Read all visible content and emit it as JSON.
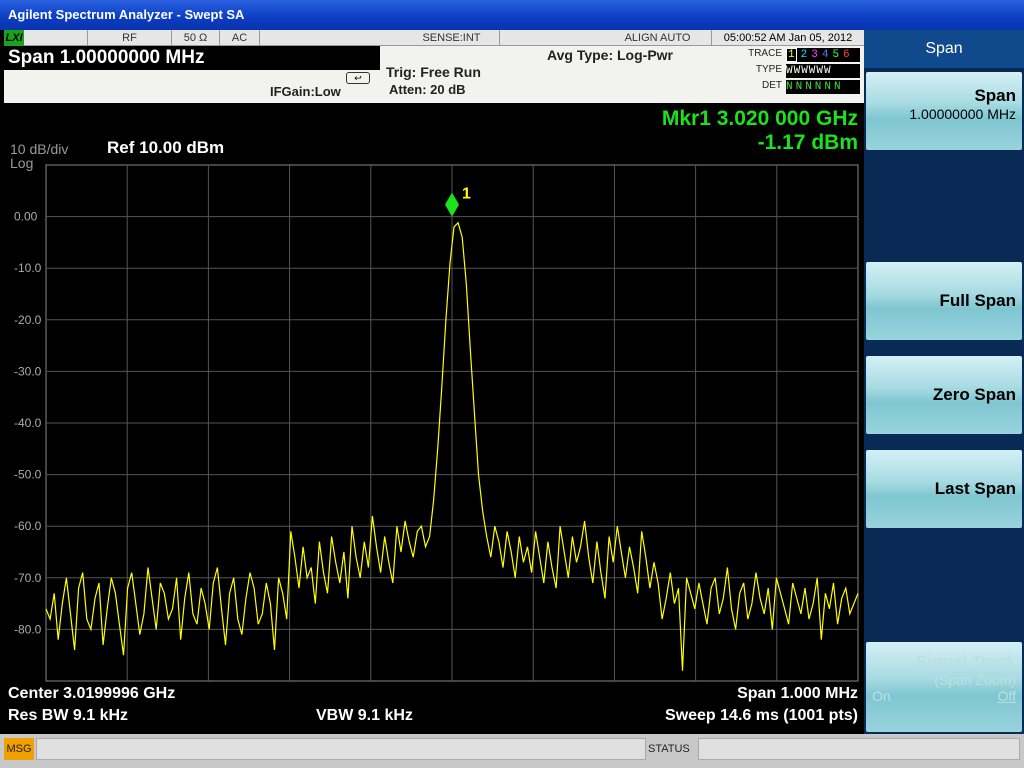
{
  "window": {
    "title": "Agilent Spectrum Analyzer - Swept SA"
  },
  "status": {
    "lxi": "LXI",
    "rf": "RF",
    "impedance": "50 Ω",
    "coupling": "AC",
    "sense": "SENSE:INT",
    "align": "ALIGN AUTO",
    "datetime": "05:00:52 AM Jan 05, 2012"
  },
  "info": {
    "span_title": "Span  1.00000000 MHz",
    "ifgain": "IFGain:Low",
    "trig": "Trig: Free Run",
    "atten": "Atten: 20 dB",
    "avg_type": "Avg Type: Log-Pwr",
    "trace_label": "TRACE",
    "type_label": "TYPE",
    "det_label": "DET",
    "trace_numbers": [
      "1",
      "2",
      "3",
      "4",
      "5",
      "6"
    ],
    "trace_colors": [
      "#ffff00",
      "#00e5ff",
      "#ff40ff",
      "#4080ff",
      "#40ff40",
      "#ff4040"
    ],
    "type_values": "WWWWWW",
    "det_values": "NNNNNN"
  },
  "plot": {
    "marker_freq": "Mkr1 3.020 000 GHz",
    "marker_amp": "-1.17 dBm",
    "scale_div": "10 dB/div",
    "scale_type": "Log",
    "ref_level": "Ref 10.00 dBm",
    "marker_label": "1",
    "center": "Center 3.0199996 GHz",
    "span": "Span 1.000 MHz",
    "res_bw": "Res BW 9.1 kHz",
    "vbw": "VBW 9.1 kHz",
    "sweep": "Sweep  14.6 ms (1001 pts)"
  },
  "chart_data": {
    "type": "line",
    "y_ticks": [
      "0.00",
      "-10.0",
      "-20.0",
      "-30.0",
      "-40.0",
      "-50.0",
      "-60.0",
      "-70.0",
      "-80.0"
    ],
    "ylim": [
      -90,
      10
    ],
    "xlim_mhz": [
      -0.5,
      0.5
    ],
    "trace_color": "#ffff00",
    "marker": {
      "x_mhz": 0.0,
      "y_dbm": -1.17
    },
    "series": [
      {
        "values_dbm": [
          -76,
          -78,
          -73,
          -82,
          -75,
          -70,
          -77,
          -84,
          -72,
          -69,
          -78,
          -80,
          -74,
          -71,
          -83,
          -76,
          -70,
          -73,
          -79,
          -85,
          -72,
          -69,
          -75,
          -81,
          -77,
          -68,
          -74,
          -80,
          -71,
          -73,
          -78,
          -76,
          -70,
          -82,
          -74,
          -69,
          -77,
          -79,
          -72,
          -75,
          -80,
          -71,
          -68,
          -76,
          -83,
          -73,
          -70,
          -78,
          -81,
          -74,
          -69,
          -72,
          -79,
          -77,
          -71,
          -75,
          -84,
          -70,
          -73,
          -78,
          -61,
          -66,
          -72,
          -64,
          -70,
          -68,
          -75,
          -63,
          -69,
          -73,
          -62,
          -67,
          -71,
          -65,
          -74,
          -60,
          -66,
          -70,
          -63,
          -68,
          -58,
          -64,
          -69,
          -62,
          -67,
          -71,
          -60,
          -65,
          -59,
          -63,
          -66,
          -61,
          -60,
          -64,
          -62,
          -55,
          -45,
          -33,
          -20,
          -9,
          -2,
          -1.2,
          -4,
          -13,
          -26,
          -38,
          -50,
          -57,
          -62,
          -66,
          -60,
          -63,
          -68,
          -61,
          -65,
          -70,
          -62,
          -67,
          -64,
          -69,
          -61,
          -66,
          -71,
          -63,
          -68,
          -72,
          -60,
          -65,
          -70,
          -62,
          -67,
          -64,
          -59,
          -66,
          -71,
          -63,
          -69,
          -74,
          -62,
          -67,
          -60,
          -65,
          -70,
          -64,
          -68,
          -73,
          -61,
          -66,
          -72,
          -67,
          -71,
          -78,
          -74,
          -69,
          -75,
          -72,
          -88,
          -70,
          -73,
          -76,
          -71,
          -75,
          -79,
          -72,
          -70,
          -77,
          -74,
          -68,
          -76,
          -80,
          -73,
          -71,
          -78,
          -75,
          -69,
          -74,
          -77,
          -72,
          -80,
          -70,
          -73,
          -76,
          -79,
          -71,
          -74,
          -77,
          -72,
          -78,
          -75,
          -70,
          -82,
          -73,
          -76,
          -71,
          -79,
          -74,
          -72,
          -77,
          -75,
          -73
        ]
      }
    ]
  },
  "softkeys": {
    "menu_title": "Span",
    "span_label": "Span",
    "span_value": "1.00000000 MHz",
    "full_span": "Full Span",
    "zero_span": "Zero Span",
    "last_span": "Last Span",
    "signal_track": "Signal Track",
    "signal_track_sub": "(Span Zoom)",
    "on": "On",
    "off": "Off"
  },
  "msgbar": {
    "msg": "MSG",
    "status": "STATUS"
  }
}
